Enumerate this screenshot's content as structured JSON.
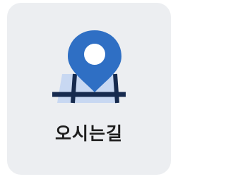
{
  "card": {
    "label": "오시는길",
    "icon": "map-pin-icon"
  },
  "colors": {
    "background": "#eceef1",
    "accent": "#2f6fc4",
    "map_fill": "#c8d8f2",
    "road": "#162a4e"
  }
}
